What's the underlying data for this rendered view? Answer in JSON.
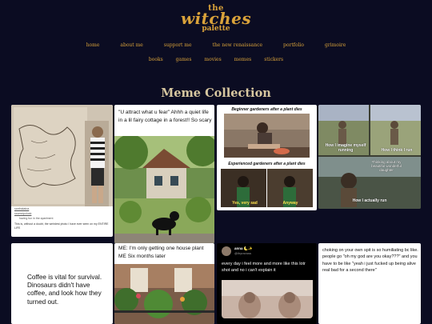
{
  "logo": {
    "line1": "the",
    "line2": "witches",
    "line3": "palette"
  },
  "nav_primary": [
    "home",
    "about me",
    "support me",
    "the new renaissance",
    "portfolio",
    "grimoire"
  ],
  "nav_secondary": [
    "books",
    "games",
    "movies",
    "memes",
    "stickers"
  ],
  "heading": "Meme Collection",
  "cards": {
    "c1": {
      "caption_user": "sanfrakatoa",
      "caption_user2": "saumnipolusk",
      "caption_line1": "having fun in the apartment",
      "caption_line2": "This is, without a doubt, the weirdest photo I have ever seen on my ENTIRE LIFE"
    },
    "c2": {
      "text": "\"U attract what u fear\" Ahhh a quiet life in a lil fairy cottage in a forest!! So scary"
    },
    "c3": {
      "top": "Beginner gardeners after a plant dies",
      "mid": "Experienced gardeners after a plant dies",
      "left_sub": "Yes, very sad",
      "right_sub": "Anyway"
    },
    "c4": {
      "t1": "How I imagine myself running",
      "t2": "How I think I run",
      "t3": "How I actually run",
      "t4": "Thinking about my beautiful wonderful daughter"
    },
    "c5": {
      "text": "Coffee is vital for survival. Dinosaurs didn't have coffee, and look how they turned out."
    },
    "c6": {
      "text": "ME: I'm only getting one house plant ME Six months later"
    },
    "c7": {
      "name": "anna 🌜✨",
      "handle": "@ihyravuss",
      "text": "every day i feel more and more like this lotr shot and no i can't explain it"
    },
    "c8": {
      "text": "choking on your own spit is so humiliating bc like. people go \"oh my god are you okay???\" and you have to be like \"yeah i just fucked up being alive real bad for a second there\""
    }
  },
  "colors": {
    "background": "#0b0c22",
    "accent": "#d9a23a",
    "heading": "#d7c7a0"
  }
}
